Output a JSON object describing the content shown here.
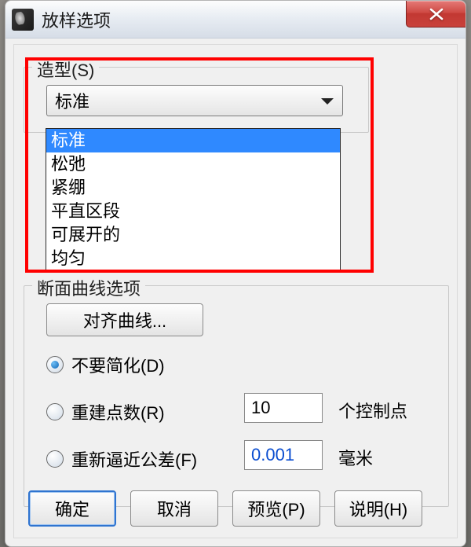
{
  "titlebar": {
    "title": "放样选项"
  },
  "style_group": {
    "legend": "造型(S)",
    "selected": "标准",
    "options": [
      "标准",
      "松弛",
      "紧绷",
      "平直区段",
      "可展开的",
      "均匀"
    ]
  },
  "section_group": {
    "legend": "断面曲线选项",
    "align_button": "对齐曲线...",
    "radios": {
      "nosimplify": {
        "label": "不要简化(D)",
        "checked": true
      },
      "rebuild": {
        "label": "重建点数(R)",
        "checked": false,
        "value": "10",
        "unit": "个控制点"
      },
      "refit": {
        "label": "重新逼近公差(F)",
        "checked": false,
        "value": "0.001",
        "unit": "毫米"
      }
    }
  },
  "buttons": {
    "ok": "确定",
    "cancel": "取消",
    "preview": "预览(P)",
    "help": "说明(H)"
  }
}
